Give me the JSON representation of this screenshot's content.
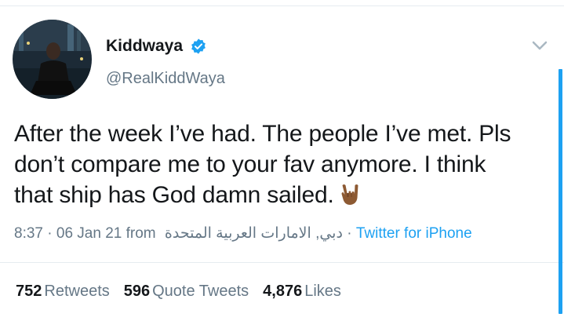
{
  "tweet": {
    "author": {
      "display_name": "Kiddwaya",
      "handle": "@RealKiddWaya",
      "verified": true
    },
    "text_lines": [
      "After the week I’ve had. The people I’ve met. Pls",
      "don’t compare me to your fav anymore. I think",
      "that ship has God damn sailed."
    ],
    "emoji": "horns-hand-emoji",
    "meta": {
      "time": "8:37",
      "separator1": " · ",
      "date": "06 Jan 21",
      "from_label": " from ",
      "location": "دبي, الامارات العربية المتحدة",
      "separator2": " · ",
      "source": "Twitter for iPhone"
    },
    "stats": {
      "retweets_count": "752",
      "retweets_label": "Retweets",
      "quote_count": "596",
      "quote_label": "Quote Tweets",
      "likes_count": "4,876",
      "likes_label": "Likes"
    }
  },
  "colors": {
    "accent": "#1da1f2",
    "text": "#14171a",
    "secondary": "#657786",
    "divider": "#e6ecf0"
  }
}
